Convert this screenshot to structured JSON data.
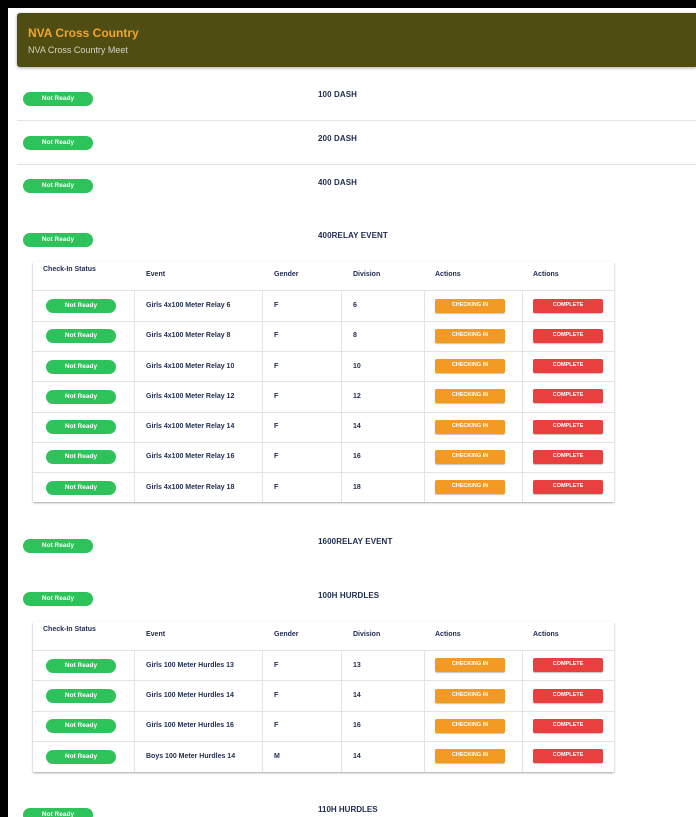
{
  "header": {
    "title": "NVA Cross Country",
    "subtitle": "NVA Cross Country Meet"
  },
  "events": [
    {
      "name": "100 DASH",
      "status": "Not Ready"
    },
    {
      "name": "200 DASH",
      "status": "Not Ready"
    },
    {
      "name": "400 DASH",
      "status": "Not Ready"
    },
    {
      "name": "400RELAY EVENT",
      "status": "Not Ready",
      "table": {
        "columns": [
          "Check-In Status",
          "Event",
          "Gender",
          "Division",
          "Actions",
          "Actions"
        ],
        "rows": [
          {
            "status": "Not Ready",
            "event": "Girls 4x100 Meter Relay 6",
            "gender": "F",
            "division": "6",
            "checkin": "CHECKING IN",
            "complete": "COMPLETE"
          },
          {
            "status": "Not Ready",
            "event": "Girls 4x100 Meter Relay 8",
            "gender": "F",
            "division": "8",
            "checkin": "CHECKING IN",
            "complete": "COMPLETE"
          },
          {
            "status": "Not Ready",
            "event": "Girls 4x100 Meter Relay 10",
            "gender": "F",
            "division": "10",
            "checkin": "CHECKING IN",
            "complete": "COMPLETE"
          },
          {
            "status": "Not Ready",
            "event": "Girls 4x100 Meter Relay 12",
            "gender": "F",
            "division": "12",
            "checkin": "CHECKING IN",
            "complete": "COMPLETE"
          },
          {
            "status": "Not Ready",
            "event": "Girls 4x100 Meter Relay 14",
            "gender": "F",
            "division": "14",
            "checkin": "CHECKING IN",
            "complete": "COMPLETE"
          },
          {
            "status": "Not Ready",
            "event": "Girls 4x100 Meter Relay 16",
            "gender": "F",
            "division": "16",
            "checkin": "CHECKING IN",
            "complete": "COMPLETE"
          },
          {
            "status": "Not Ready",
            "event": "Girls 4x100 Meter Relay 18",
            "gender": "F",
            "division": "18",
            "checkin": "CHECKING IN",
            "complete": "COMPLETE"
          }
        ]
      }
    },
    {
      "name": "1600RELAY EVENT",
      "status": "Not Ready"
    },
    {
      "name": "100H HURDLES",
      "status": "Not Ready",
      "table": {
        "columns": [
          "Check-In Status",
          "Event",
          "Gender",
          "Division",
          "Actions",
          "Actions"
        ],
        "rows": [
          {
            "status": "Not Ready",
            "event": "Girls 100 Meter Hurdles 13",
            "gender": "F",
            "division": "13",
            "checkin": "CHECKING IN",
            "complete": "COMPLETE"
          },
          {
            "status": "Not Ready",
            "event": "Girls 100 Meter Hurdles 14",
            "gender": "F",
            "division": "14",
            "checkin": "CHECKING IN",
            "complete": "COMPLETE"
          },
          {
            "status": "Not Ready",
            "event": "Girls 100 Meter Hurdles 16",
            "gender": "F",
            "division": "16",
            "checkin": "CHECKING IN",
            "complete": "COMPLETE"
          },
          {
            "status": "Not Ready",
            "event": "Boys 100 Meter Hurdles 14",
            "gender": "M",
            "division": "14",
            "checkin": "CHECKING IN",
            "complete": "COMPLETE"
          }
        ]
      }
    },
    {
      "name": "110H HURDLES",
      "status": "Not Ready"
    }
  ]
}
